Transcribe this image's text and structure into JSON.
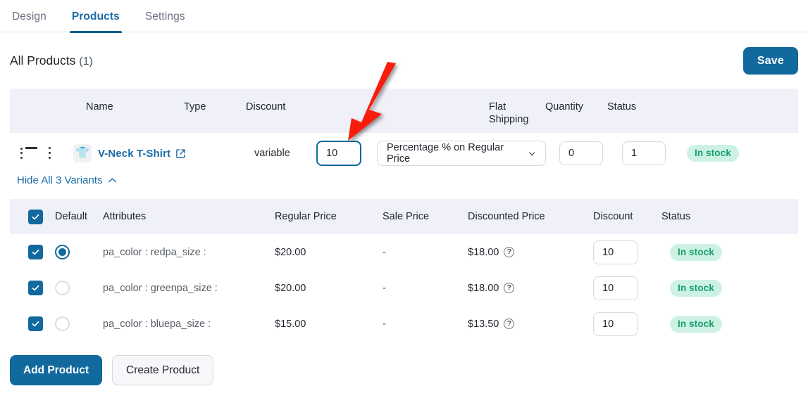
{
  "tabs": [
    {
      "label": "Design",
      "active": false
    },
    {
      "label": "Products",
      "active": true
    },
    {
      "label": "Settings",
      "active": false
    }
  ],
  "header": {
    "title": "All Products",
    "count": "(1)",
    "save_label": "Save"
  },
  "products_table": {
    "columns": {
      "name": "Name",
      "type": "Type",
      "discount": "Discount",
      "flat_shipping": "Flat Shipping",
      "quantity": "Quantity",
      "status": "Status"
    },
    "rows": [
      {
        "thumb_icon": "tshirt-icon",
        "name": "V-Neck T-Shirt",
        "type": "variable",
        "discount_value": "10",
        "discount_type": "Percentage % on Regular Price",
        "flat_shipping": "0",
        "quantity": "1",
        "status": "In stock"
      }
    ]
  },
  "variants_toggle": {
    "label": "Hide All 3 Variants",
    "icon": "chevron-up-icon"
  },
  "variants_table": {
    "columns": {
      "default": "Default",
      "attributes": "Attributes",
      "regular_price": "Regular Price",
      "sale_price": "Sale Price",
      "discounted_price": "Discounted Price",
      "discount": "Discount",
      "status": "Status"
    },
    "rows": [
      {
        "selected": true,
        "is_default": true,
        "attributes": "pa_color : redpa_size :",
        "regular_price": "$20.00",
        "sale_price": "-",
        "discounted_price": "$18.00",
        "discount": "10",
        "status": "In stock"
      },
      {
        "selected": true,
        "is_default": false,
        "attributes": "pa_color : greenpa_size :",
        "regular_price": "$20.00",
        "sale_price": "-",
        "discounted_price": "$18.00",
        "discount": "10",
        "status": "In stock"
      },
      {
        "selected": true,
        "is_default": false,
        "attributes": "pa_color : bluepa_size :",
        "regular_price": "$15.00",
        "sale_price": "-",
        "discounted_price": "$13.50",
        "discount": "10",
        "status": "In stock"
      }
    ]
  },
  "footer": {
    "add_product": "Add Product",
    "create_product": "Create Product"
  },
  "annotation": {
    "type": "arrow",
    "color": "#f81a08",
    "points_to": "discount-input"
  },
  "colors": {
    "accent": "#12699d",
    "link": "#1b6ca8",
    "table_header_bg": "#eff0f8",
    "badge_bg": "#cdf2e4",
    "badge_text": "#18a06f",
    "annotation_red": "#f81a08"
  }
}
